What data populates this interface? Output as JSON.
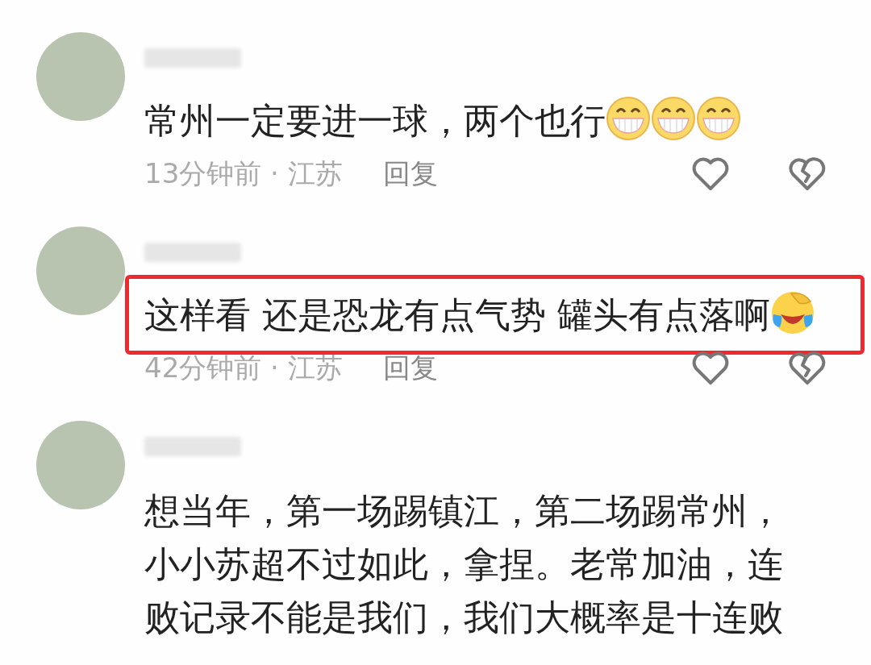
{
  "comments": [
    {
      "text": "常州一定要进一球，两个也行",
      "emojis": [
        {
          "kind": "grin"
        },
        {
          "kind": "grin"
        },
        {
          "kind": "grin"
        }
      ],
      "highlighted": false,
      "meta": "13分钟前 · 江苏",
      "reply": "回复"
    },
    {
      "text": "这样看 还是恐龙有点气势 罐头有点落啊",
      "emojis": [
        {
          "kind": "laugh-cry"
        }
      ],
      "highlighted": true,
      "meta": "42分钟前 · 江苏",
      "reply": "回复"
    },
    {
      "text": "想当年，第一场踢镇江，第二场踢常州，小小苏超不过如此，拿捏。老常加油，连败记录不能是我们，我们大概率是十连败",
      "highlighted": false
    }
  ]
}
